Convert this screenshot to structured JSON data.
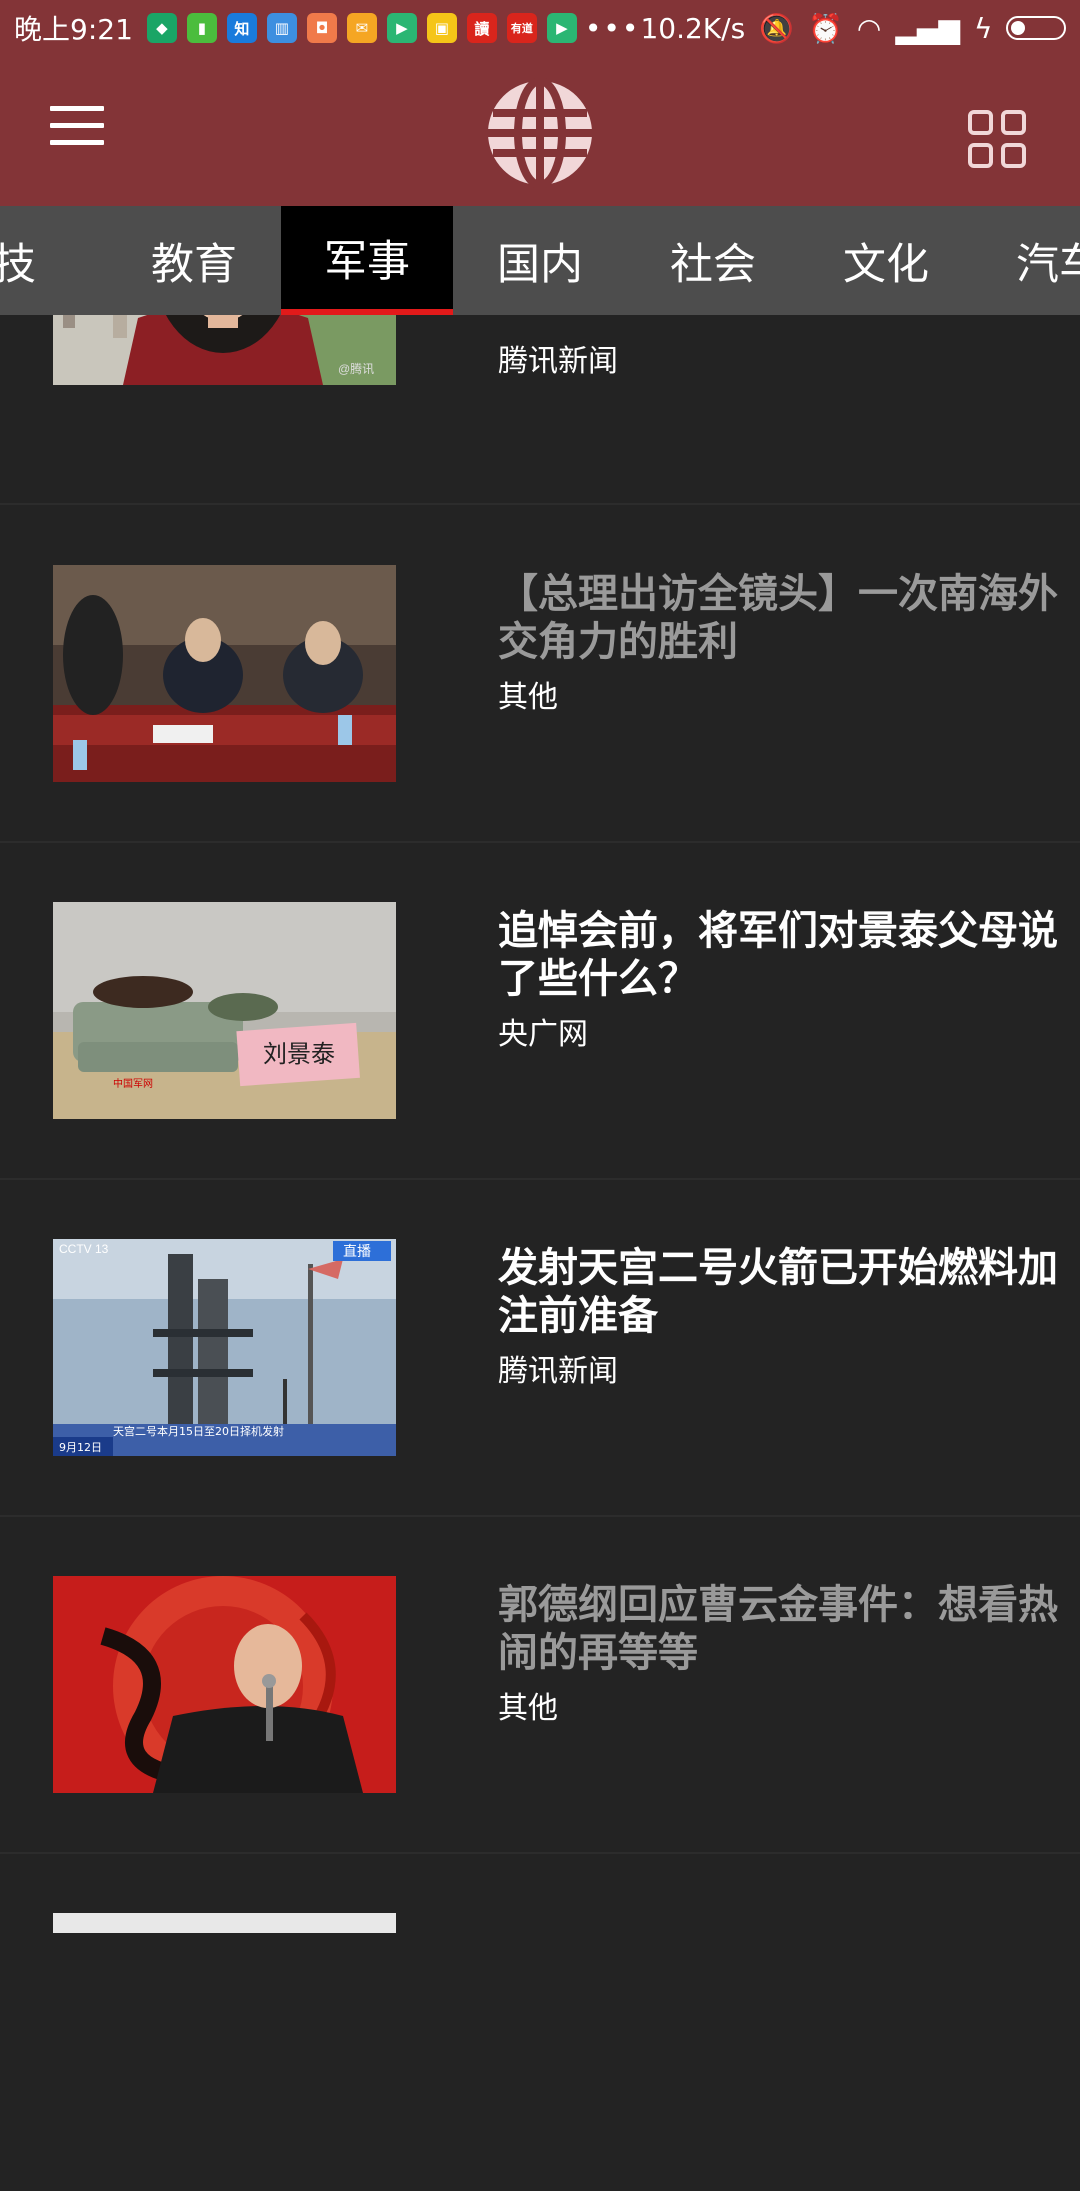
{
  "status_bar": {
    "time": "晚上9:21",
    "net_speed": "10.2K/s",
    "dots": "•••",
    "notification_icons": [
      {
        "name": "shield-app-icon",
        "color": "#1aa566",
        "glyph": "◆"
      },
      {
        "name": "battery-app-icon",
        "color": "#4bbd3d",
        "glyph": "▮"
      },
      {
        "name": "zhihu-app-icon",
        "color": "#1a7bdc",
        "glyph": "知"
      },
      {
        "name": "reader-app-icon",
        "color": "#3d8fe0",
        "glyph": "▥"
      },
      {
        "name": "shop-app-icon",
        "color": "#f07a4a",
        "glyph": "◘"
      },
      {
        "name": "mail-app-icon",
        "color": "#f5a623",
        "glyph": "✉"
      },
      {
        "name": "video-app-icon",
        "color": "#2bb673",
        "glyph": "▶"
      },
      {
        "name": "box-app-icon",
        "color": "#f5c518",
        "glyph": "▣"
      },
      {
        "name": "du-app-icon",
        "color": "#d9251c",
        "glyph": "讀"
      },
      {
        "name": "youdao-app-icon",
        "color": "#d9251c",
        "glyph": "有道"
      },
      {
        "name": "play-app-icon",
        "color": "#2bb673",
        "glyph": "▶"
      }
    ]
  },
  "header": {
    "menu_icon": "hamburger-menu-icon",
    "logo_icon": "globe-logo-icon",
    "grid_icon": "grid-icon"
  },
  "tabs": [
    {
      "label": "科技",
      "active": false
    },
    {
      "label": "教育",
      "active": false
    },
    {
      "label": "军事",
      "active": true
    },
    {
      "label": "国内",
      "active": false
    },
    {
      "label": "社会",
      "active": false
    },
    {
      "label": "文化",
      "active": false
    },
    {
      "label": "汽车",
      "active": false
    }
  ],
  "colors": {
    "accent": "#833437",
    "tab_bg": "#4d4d4d",
    "active_tab": "#000000",
    "indicator": "#e21a1a",
    "feed_bg": "#232323"
  },
  "news": [
    {
      "title": "",
      "source": "腾讯新闻",
      "read": false
    },
    {
      "title": "【总理出访全镜头】一次南海外交角力的胜利",
      "source": "其他",
      "read": true
    },
    {
      "title": "追悼会前，将军们对景泰父母说了些什么？",
      "source": "央广网",
      "read": false
    },
    {
      "title": "发射天宫二号火箭已开始燃料加注前准备",
      "source": "腾讯新闻",
      "read": false
    },
    {
      "title": "郭德纲回应曹云金事件：想看热闹的再等等",
      "source": "其他",
      "read": true
    }
  ],
  "images": {
    "nameplate": "刘景泰",
    "cctv_logo": "CCTV 13",
    "live_badge": "直播",
    "caption": "天宫二号本月15日至20日择机发射",
    "date": "9月12日",
    "military_logo": "中国军网"
  }
}
